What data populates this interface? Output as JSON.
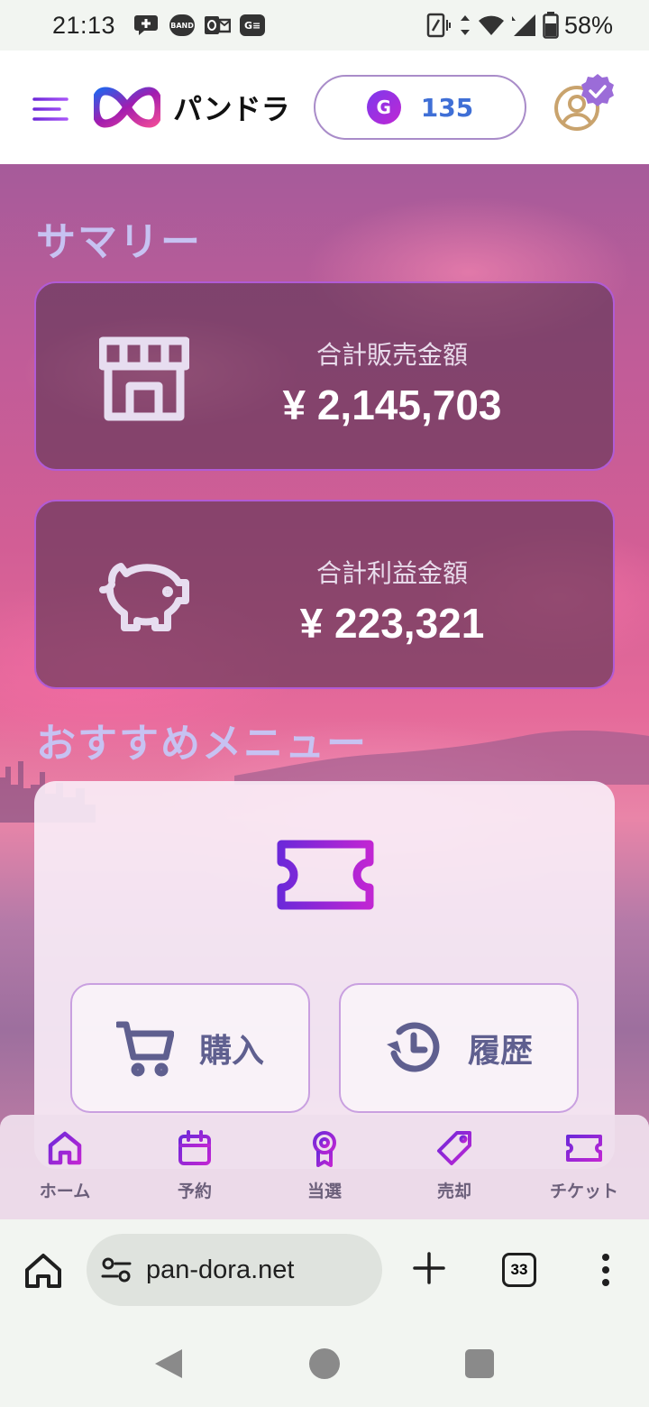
{
  "status_bar": {
    "time": "21:13",
    "battery": "58%",
    "notif_icons": [
      "chat-plus-icon",
      "band-icon",
      "outlook-icon",
      "ge-icon"
    ],
    "band_label": "BAND",
    "ge_label": "G≡"
  },
  "header": {
    "brand": "パンドラ",
    "coin_letter": "G",
    "points": "135"
  },
  "summary": {
    "title": "サマリー",
    "sales_label": "合計販売金額",
    "sales_value": "¥ 2,145,703",
    "profit_label": "合計利益金額",
    "profit_value": "¥ 223,321"
  },
  "recommended": {
    "title": "おすすめメニュー",
    "buy_label": "購入",
    "history_label": "履歴"
  },
  "bottom_nav": {
    "items": [
      {
        "label": "ホーム",
        "icon": "home-icon"
      },
      {
        "label": "予約",
        "icon": "calendar-icon"
      },
      {
        "label": "当選",
        "icon": "award-icon"
      },
      {
        "label": "売却",
        "icon": "tag-icon"
      },
      {
        "label": "チケット",
        "icon": "ticket-icon"
      }
    ]
  },
  "browser": {
    "url": "pan-dora.net",
    "tab_count": "33"
  },
  "colors": {
    "accent_purple": "#7c3aed",
    "accent_magenta": "#c026d3",
    "points_blue": "#3f6fd6",
    "section_title": "#c7c2f2",
    "card_border": "#b15bd6"
  }
}
